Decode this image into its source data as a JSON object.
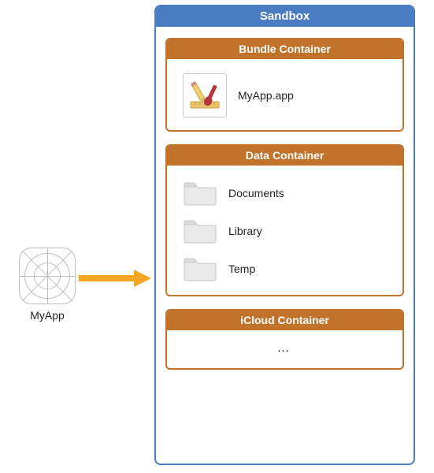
{
  "app": {
    "label": "MyApp"
  },
  "sandbox": {
    "title": "Sandbox",
    "bundle": {
      "title": "Bundle Container",
      "item_label": "MyApp.app"
    },
    "data": {
      "title": "Data Container",
      "folders": [
        {
          "label": "Documents"
        },
        {
          "label": "Library"
        },
        {
          "label": "Temp"
        }
      ]
    },
    "icloud": {
      "title": "iCloud Container",
      "body": "…"
    }
  },
  "colors": {
    "sandbox_border": "#4a7cc2",
    "container_border": "#c1732c",
    "arrow": "#f5a623"
  }
}
